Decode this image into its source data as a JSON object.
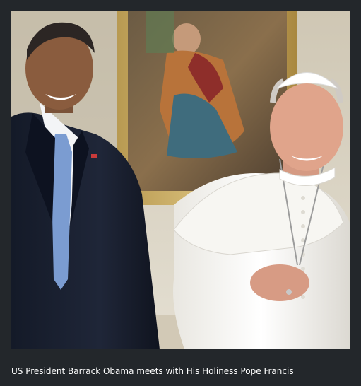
{
  "photo": {
    "subjects": [
      "man-in-dark-suit",
      "man-in-white-cassock"
    ]
  },
  "caption": {
    "text": "US President Barrack Obama meets with His Holiness Pope Francis"
  },
  "colors": {
    "background": "#23272b",
    "caption_text": "#ffffff"
  }
}
